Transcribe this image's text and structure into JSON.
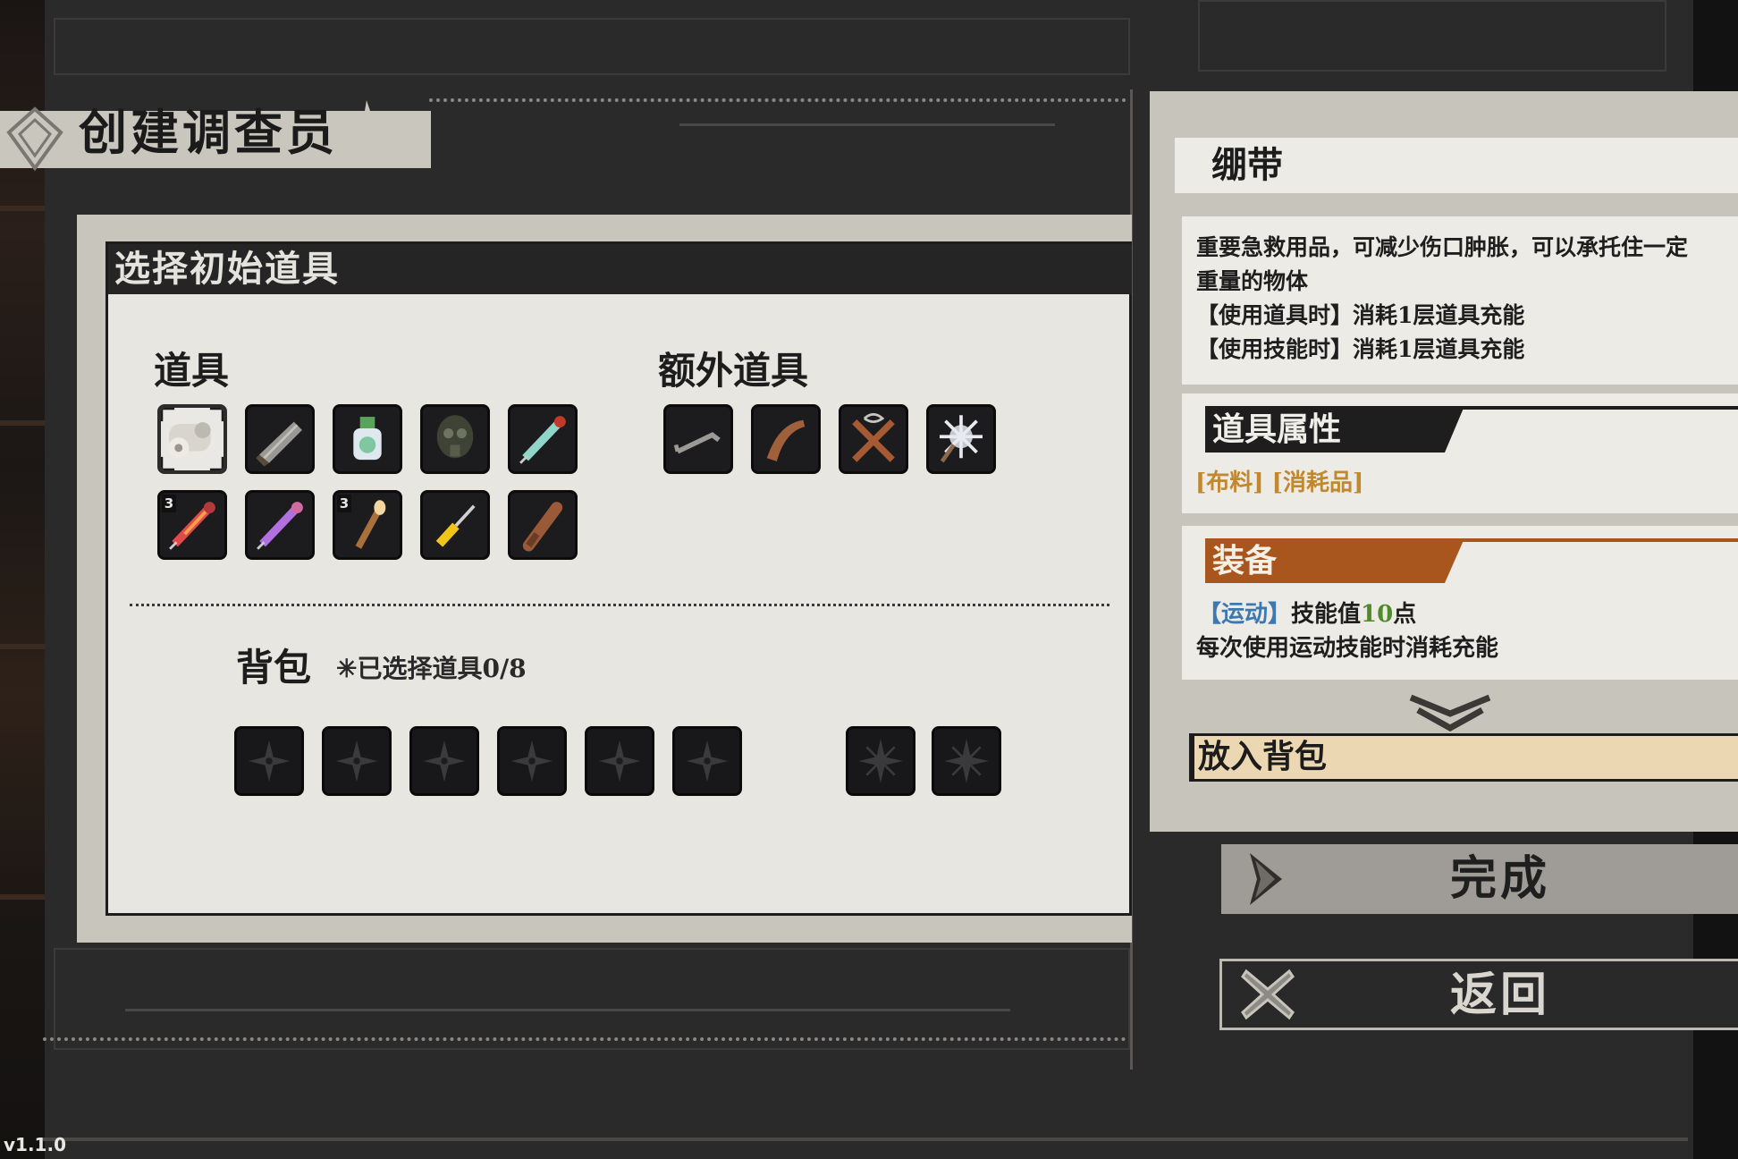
{
  "header": {
    "title": "创建调查员"
  },
  "main": {
    "panel_title": "选择初始道具",
    "items_label": "道具",
    "extra_items_label": "额外道具",
    "items": [
      {
        "icon": "bandage-roll-icon",
        "count": "",
        "selected": true
      },
      {
        "icon": "cleaver-icon",
        "count": ""
      },
      {
        "icon": "potion-bottle-icon",
        "count": ""
      },
      {
        "icon": "gas-mask-icon",
        "count": ""
      },
      {
        "icon": "green-syringe-icon",
        "count": ""
      },
      {
        "icon": "red-syringe-icon",
        "count": "3"
      },
      {
        "icon": "purple-syringe-icon",
        "count": ""
      },
      {
        "icon": "torch-icon",
        "count": "3"
      },
      {
        "icon": "screwdriver-icon",
        "count": ""
      },
      {
        "icon": "wooden-club-icon",
        "count": ""
      }
    ],
    "extra_items": [
      {
        "icon": "crowbar-icon"
      },
      {
        "icon": "boomerang-icon"
      },
      {
        "icon": "crossed-bats-icon"
      },
      {
        "icon": "spiked-mace-icon"
      }
    ],
    "bag_label": "背包",
    "bag_count": "✳已选择道具0/8",
    "bag_slots": [
      1,
      2,
      3,
      4,
      5,
      6
    ],
    "bag_extra_slots": [
      1,
      2
    ]
  },
  "detail": {
    "item_name": "绷带",
    "description": [
      "重要急救用品，可减少伤口肿胀，可以承托住一定",
      "重量的物体",
      "【使用道具时】消耗1层道具充能",
      "【使用技能时】消耗1层道具充能"
    ],
    "attributes_title": "道具属性",
    "attributes_tags": "[布料] [消耗品]",
    "equip_title": "装备",
    "equip_skill_tag": "【运动】",
    "equip_skill_text": "技能值",
    "equip_skill_value": "10",
    "equip_skill_unit": "点",
    "equip_note": "每次使用运动技能时消耗充能",
    "put_in_bag": "放入背包"
  },
  "buttons": {
    "done": "完成",
    "back": "返回"
  },
  "version": "v1.1.0",
  "colors": {
    "equip_accent": "#a9561e",
    "tag_color": "#c0882f",
    "skill_tag": "#3d78b0",
    "skill_value": "#4f8a2d"
  }
}
